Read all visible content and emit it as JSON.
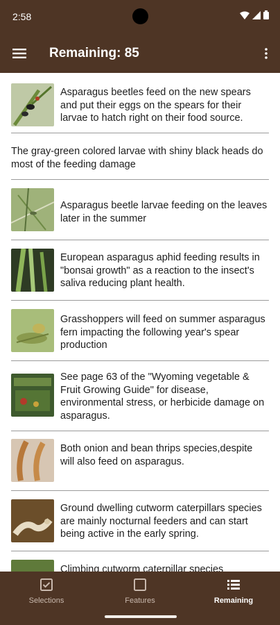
{
  "status": {
    "time": "2:58"
  },
  "header": {
    "title": "Remaining: 85"
  },
  "items": [
    {
      "text": "Asparagus beetles feed on the new spears and put their eggs on the spears for their larvae to hatch right on their food source."
    },
    {
      "text": "The gray-green colored larvae with shiny black heads do most of the feeding damage"
    },
    {
      "text": "Asparagus beetle larvae feeding on the leaves later in the summer"
    },
    {
      "text": "European asparagus aphid feeding results in \"bonsai growth\" as a reaction to the insect's saliva reducing plant health."
    },
    {
      "text": "Grasshoppers will feed on summer asparagus fern impacting the following year's spear production"
    },
    {
      "text": "See page 63 of the \"Wyoming vegetable & Fruit Growing Guide\" for disease, environmental stress, or herbicide damage on asparagus."
    },
    {
      "text": "Both onion and bean thrips species,despite will also feed on asparagus."
    },
    {
      "text": "Ground dwelling cutworm caterpillars species are mainly nocturnal feeders and can start being active in the early spring."
    },
    {
      "text": "Climbing cutworm caterpillar species"
    }
  ],
  "bottom_nav": {
    "selections": "Selections",
    "features": "Features",
    "remaining": "Remaining"
  },
  "colors": {
    "brand": "#4e3525",
    "divider": "#9a9a9a"
  }
}
